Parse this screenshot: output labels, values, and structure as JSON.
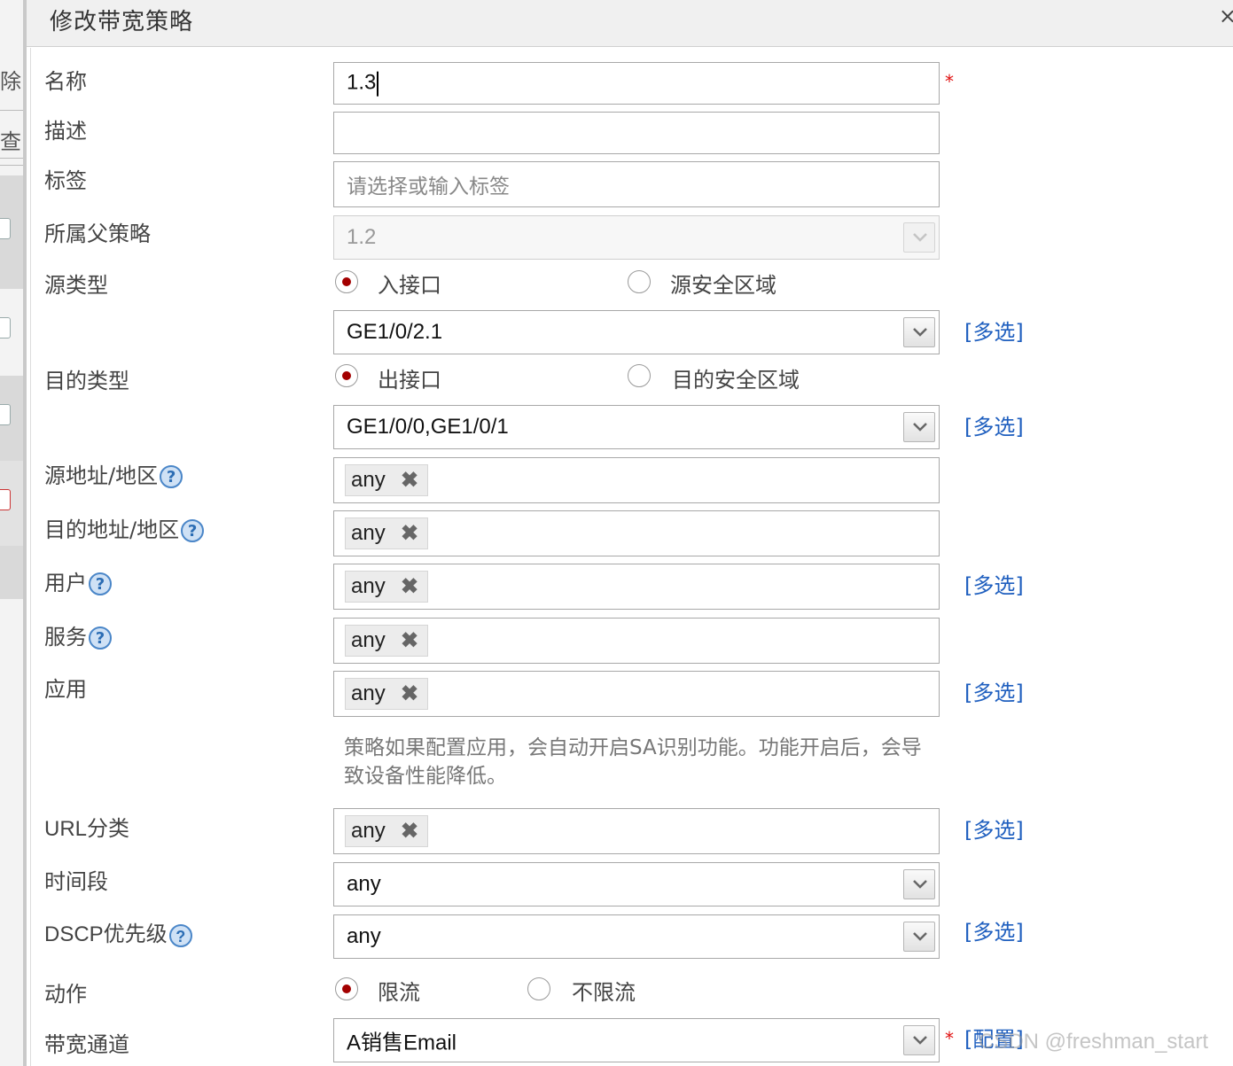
{
  "background": {
    "fragment_1": "除",
    "fragment_2": "查"
  },
  "dialog": {
    "title": "修改带宽策略",
    "close": "×"
  },
  "form": {
    "name": {
      "label": "名称",
      "value": "1.3"
    },
    "description": {
      "label": "描述",
      "value": ""
    },
    "tags": {
      "label": "标签",
      "placeholder": "请选择或输入标签"
    },
    "parent_policy": {
      "label": "所属父策略",
      "value": "1.2"
    },
    "source_type": {
      "label": "源类型",
      "option_1": "入接口",
      "option_2": "源安全区域",
      "selected": "入接口"
    },
    "source_interface": {
      "value": "GE1/0/2.1"
    },
    "dest_type": {
      "label": "目的类型",
      "option_1": "出接口",
      "option_2": "目的安全区域",
      "selected": "出接口"
    },
    "dest_interface": {
      "value": "GE1/0/0,GE1/0/1"
    },
    "source_address": {
      "label": "源地址/地区",
      "tag": "any"
    },
    "dest_address": {
      "label": "目的地址/地区",
      "tag": "any"
    },
    "user": {
      "label": "用户",
      "tag": "any"
    },
    "service": {
      "label": "服务",
      "tag": "any"
    },
    "application": {
      "label": "应用",
      "tag": "any"
    },
    "app_hint": "策略如果配置应用，会自动开启SA识别功能。功能开启后，会导致设备性能降低。",
    "url_category": {
      "label": "URL分类",
      "tag": "any"
    },
    "time_range": {
      "label": "时间段",
      "value": "any"
    },
    "dscp": {
      "label": "DSCP优先级",
      "value": "any"
    },
    "action": {
      "label": "动作",
      "option_1": "限流",
      "option_2": "不限流",
      "selected": "限流"
    },
    "bandwidth_channel": {
      "label": "带宽通道",
      "value": "A销售Email"
    }
  },
  "links": {
    "multi_select": "[多选]",
    "configure": "[配置]"
  },
  "required_mark": "*",
  "help_mark": "?",
  "tag_remove": "✖",
  "watermark": "CSDN @freshman_start",
  "colors": {
    "link": "#1f5fbf",
    "required": "#e01010",
    "radio_selected": "#a30000",
    "help_icon": "#2c6db4"
  }
}
